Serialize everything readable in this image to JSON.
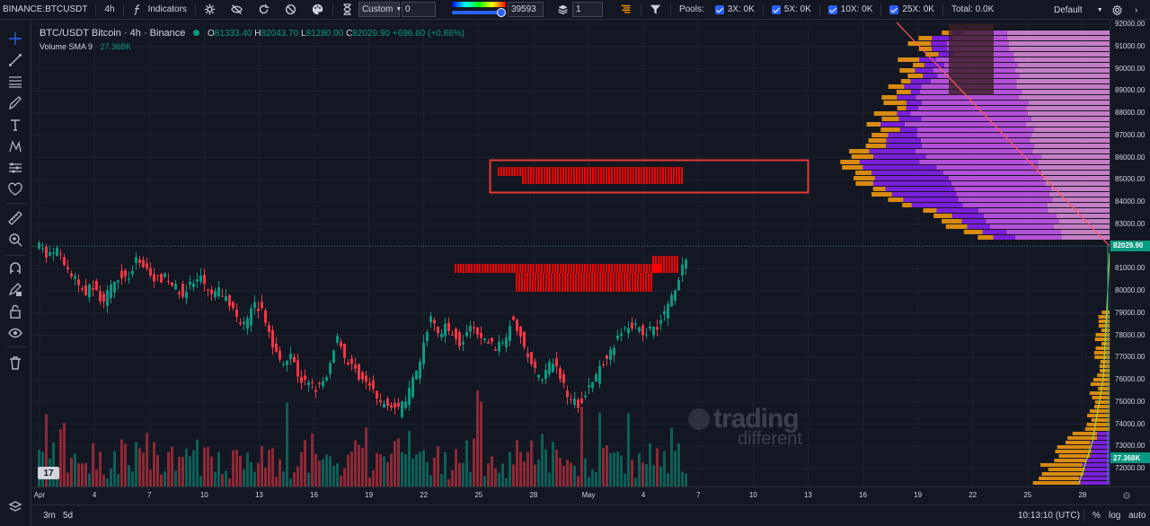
{
  "toolbar": {
    "symbol": "BINANCE:BTCUSDT",
    "interval": "4h",
    "indicators_label": "Indicators",
    "custom_select": "Custom",
    "custom_value": "0",
    "range_value": "39593",
    "layers_value": "1",
    "pools_label": "Pools:",
    "pool_3x": "3X: 0K",
    "pool_5x": "5X: 0K",
    "pool_10x": "10X: 0K",
    "pool_25x": "25X: 0K",
    "total": "Total: 0.0K",
    "layout_name": "Default"
  },
  "legend": {
    "title": "BTC/USDT Bitcoin · 4h · Binance",
    "o_key": "O",
    "o_val": "81333.40",
    "h_key": "H",
    "h_val": "82043.70",
    "l_key": "L",
    "l_val": "81280.00",
    "c_key": "C",
    "c_val": "82029.90",
    "change": "+696.60 (+0.86%)",
    "volume_label": "Volume SMA 9",
    "volume_value": "27.36BK"
  },
  "watermark": {
    "line1": "trading",
    "line2": "different"
  },
  "price_scale": {
    "ticks": [
      "92000.00",
      "91000.00",
      "90000.00",
      "89000.00",
      "88000.00",
      "87000.00",
      "86000.00",
      "85000.00",
      "84000.00",
      "83000.00",
      "81000.00",
      "80000.00",
      "79000.00",
      "78000.00",
      "77000.00",
      "76000.00",
      "75000.00",
      "74000.00",
      "73000.00",
      "72000.00"
    ],
    "last_price": "82029.90",
    "volume_tag": "27.368K"
  },
  "time_axis": {
    "labels": [
      "Apr",
      "4",
      "7",
      "10",
      "13",
      "16",
      "19",
      "22",
      "25",
      "28",
      "May",
      "4",
      "7",
      "10",
      "13",
      "16",
      "19",
      "22",
      "25",
      "28"
    ]
  },
  "bottom": {
    "range_3m": "3m",
    "range_5d": "5d",
    "clock": "10:13:10 (UTC)",
    "pct": "%",
    "log": "log",
    "auto": "auto"
  },
  "colors": {
    "up": "#089981",
    "down": "#f23645",
    "liquidation_bar": "#ff0000",
    "highlight_box": "#e53935",
    "price_line": "#26a69a"
  }
}
